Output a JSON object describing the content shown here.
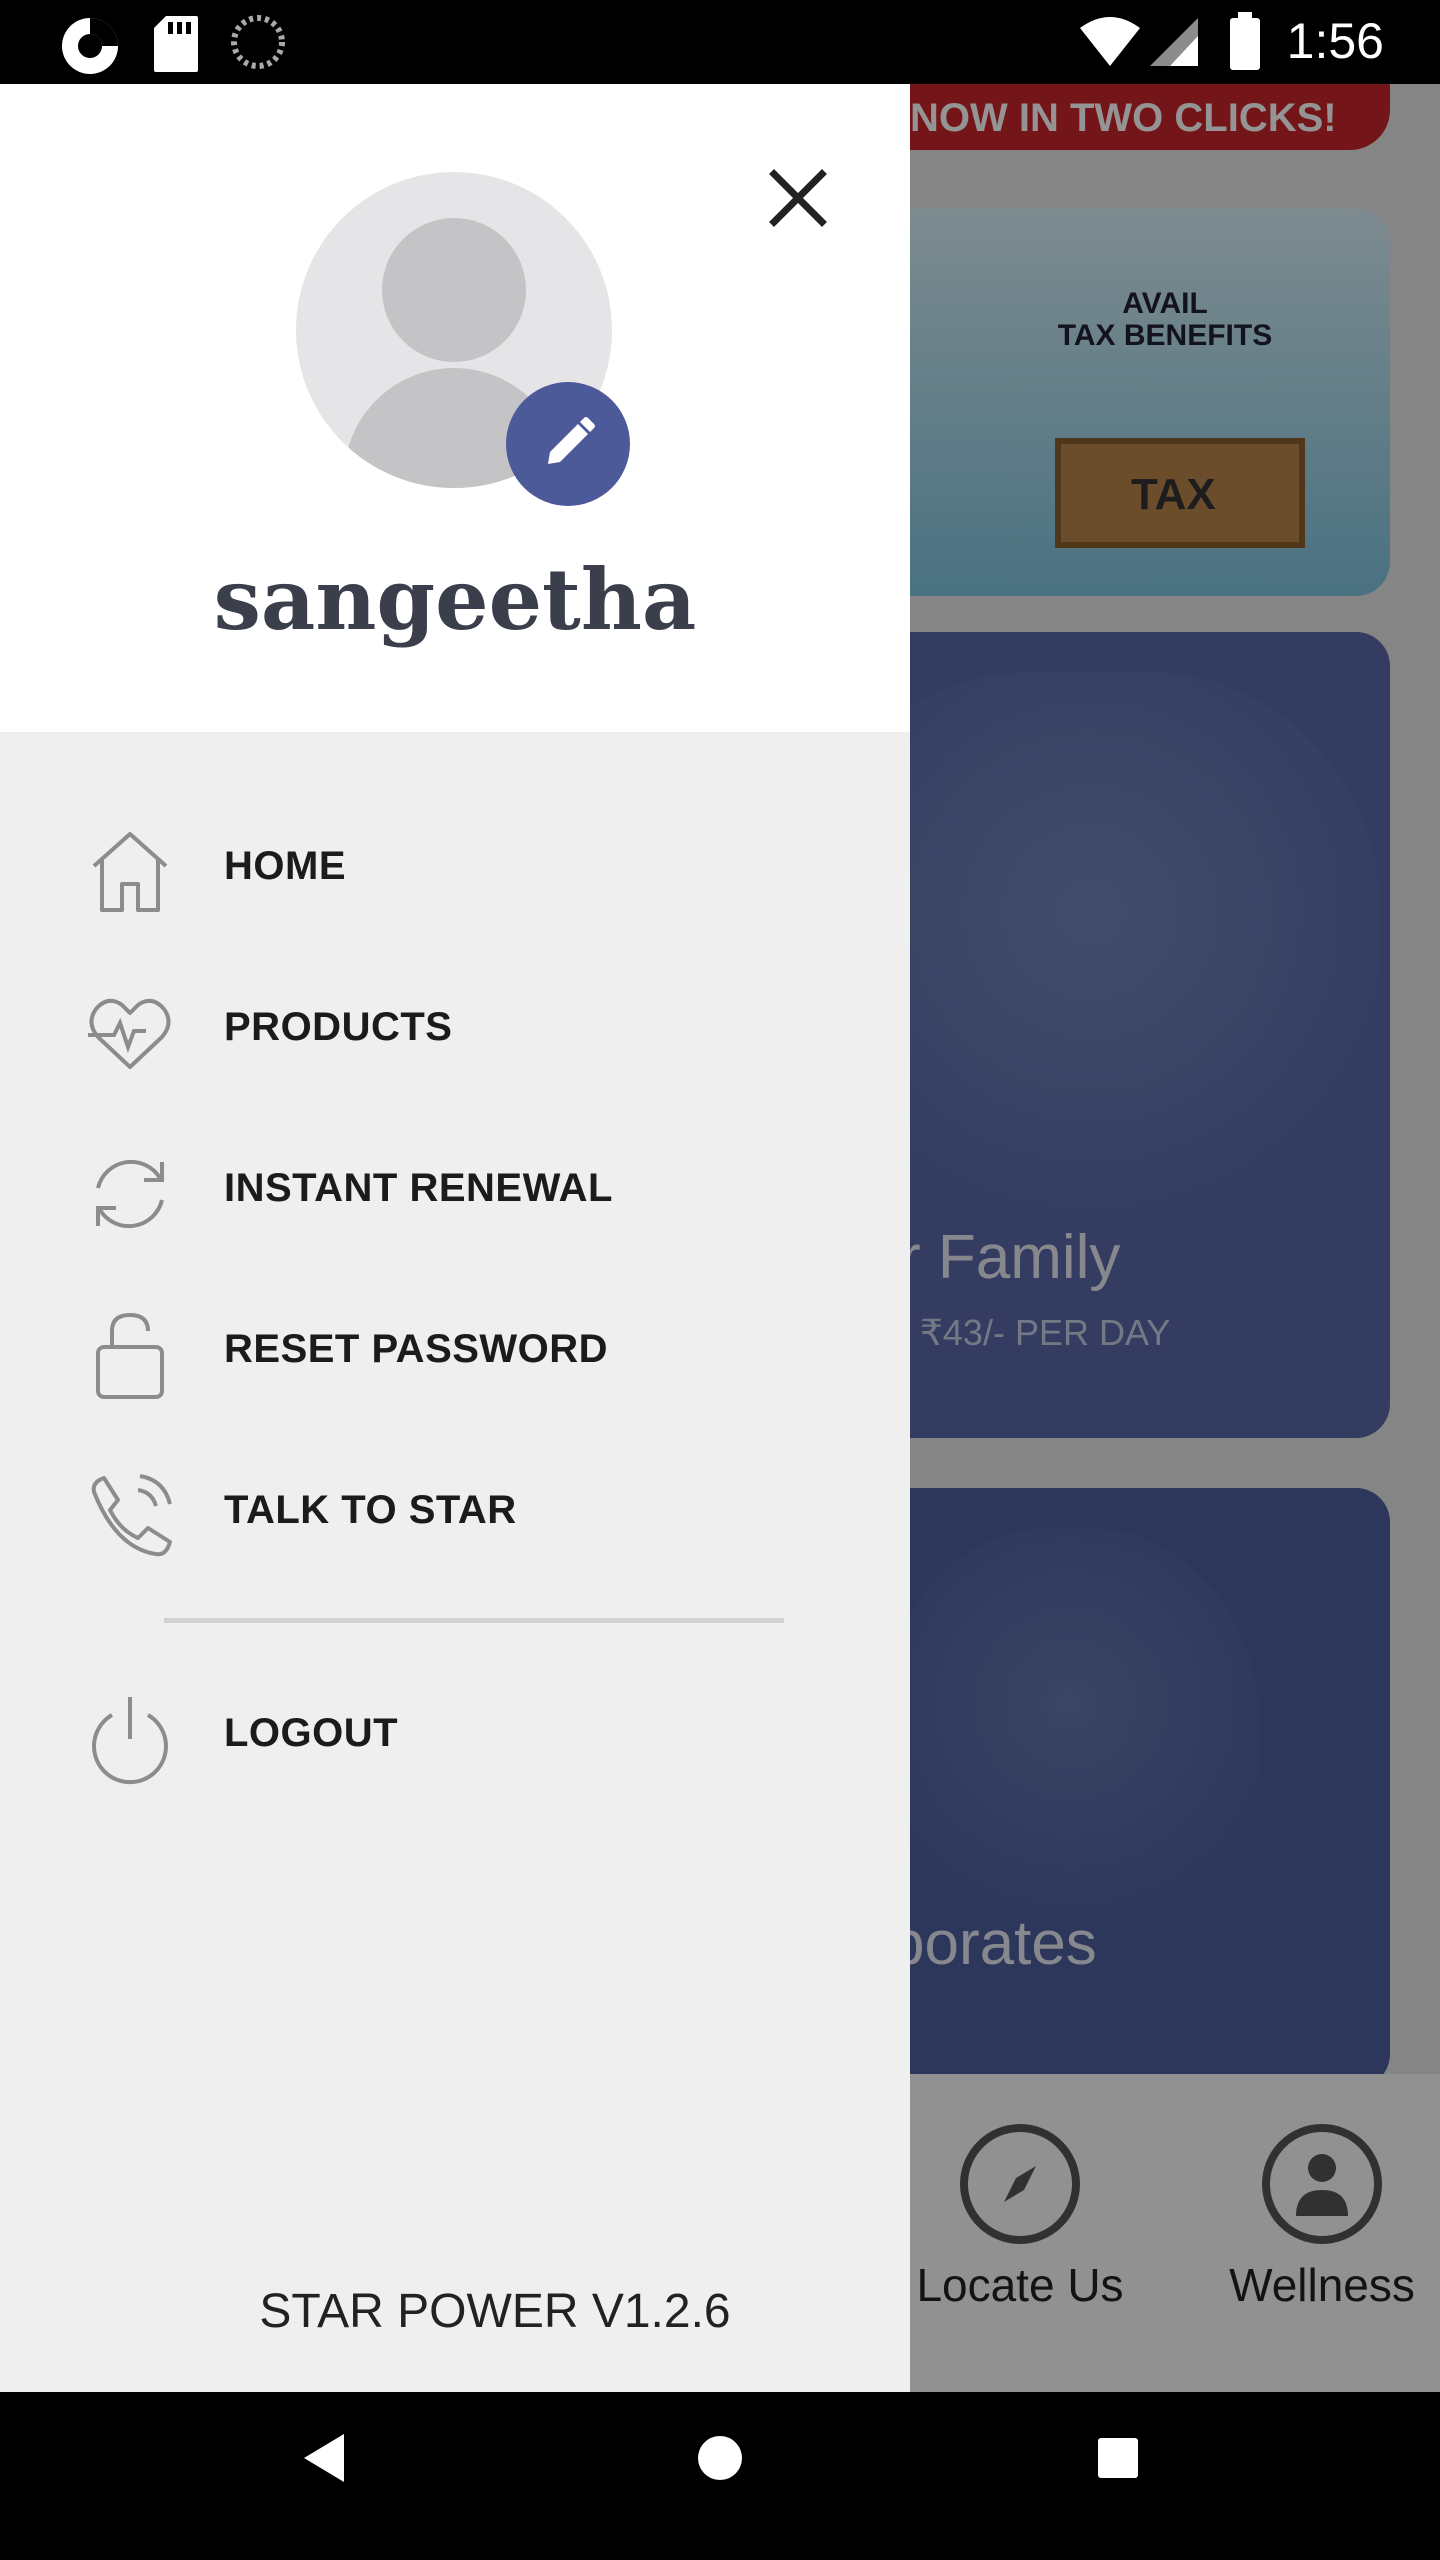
{
  "status_bar": {
    "time": "1:56",
    "left_icons": [
      "app-notification-icon",
      "sd-card-icon",
      "sync-icon"
    ],
    "right_icons": [
      "wifi-icon",
      "cell-signal-icon",
      "battery-icon"
    ]
  },
  "background": {
    "promo_banner": "NOW IN TWO CLICKS!",
    "tax_card": {
      "title_line1": "AVAIL",
      "title_line2": "TAX BENEFITS",
      "crate_label": "TAX"
    },
    "family_card": {
      "title": "r Family",
      "subtitle": "₹43/- PER DAY"
    },
    "corporate_card": {
      "title": "porates"
    },
    "bottom_nav": [
      {
        "label": "Locate Us",
        "icon": "compass-icon"
      },
      {
        "label": "Wellness",
        "icon": "person-icon"
      }
    ]
  },
  "drawer": {
    "user_name": "sangeetha",
    "menu": [
      {
        "label": "HOME",
        "icon": "home-icon"
      },
      {
        "label": "PRODUCTS",
        "icon": "heartbeat-icon"
      },
      {
        "label": "INSTANT RENEWAL",
        "icon": "refresh-icon"
      },
      {
        "label": "RESET PASSWORD",
        "icon": "lock-icon"
      },
      {
        "label": "TALK TO STAR",
        "icon": "phone-icon"
      }
    ],
    "logout": {
      "label": "LOGOUT",
      "icon": "power-icon"
    },
    "version": "STAR POWER V1.2.6"
  },
  "colors": {
    "accent": "#4c5a9a",
    "promo_red": "#c9252c",
    "drawer_bg": "#efefef",
    "header_bg": "#ffffff"
  }
}
